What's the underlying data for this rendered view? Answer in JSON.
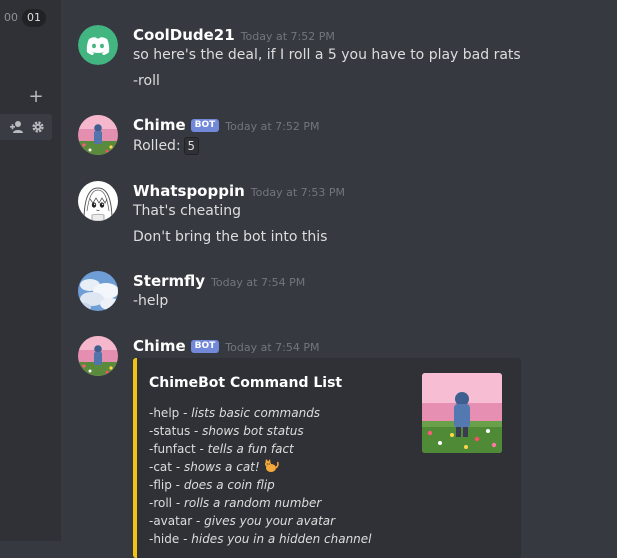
{
  "sidebar": {
    "badge_left": "00",
    "badge_right": "01",
    "plus_label": "+"
  },
  "messages": [
    {
      "author": "CoolDude21",
      "timestamp": "Today at 7:52 PM",
      "lines": [
        "so here's the deal, if I roll a 5 you have to play bad rats",
        "-roll"
      ]
    },
    {
      "author": "Chime",
      "bot_tag": "BOT",
      "timestamp": "Today at 7:52 PM",
      "rolled_label": "Rolled:",
      "rolled_value": "5"
    },
    {
      "author": "Whatspoppin",
      "timestamp": "Today at 7:53 PM",
      "lines": [
        "That's cheating",
        "Don't bring the bot into this"
      ]
    },
    {
      "author": "Stermfly",
      "timestamp": "Today at 7:54 PM",
      "lines": [
        "-help"
      ]
    },
    {
      "author": "Chime",
      "bot_tag": "BOT",
      "timestamp": "Today at 7:54 PM",
      "embed": {
        "title": "ChimeBot Command List",
        "accent_color": "#f1c40f",
        "commands": [
          {
            "cmd": "-help",
            "sep": " - ",
            "desc": "lists basic commands"
          },
          {
            "cmd": "-status",
            "sep": " - ",
            "desc": "shows bot status"
          },
          {
            "cmd": "-funfact",
            "sep": " - ",
            "desc": "tells a fun fact"
          },
          {
            "cmd": "-cat",
            "sep": " - ",
            "desc": "shows a cat!"
          },
          {
            "cmd": "-flip",
            "sep": " - ",
            "desc": "does a coin flip"
          },
          {
            "cmd": "-roll",
            "sep": " - ",
            "desc": "rolls a random number"
          },
          {
            "cmd": "-avatar",
            "sep": " - ",
            "desc": "gives you your avatar"
          },
          {
            "cmd": "-hide",
            "sep": " - ",
            "desc": "hides you in a hidden channel"
          }
        ]
      }
    }
  ]
}
